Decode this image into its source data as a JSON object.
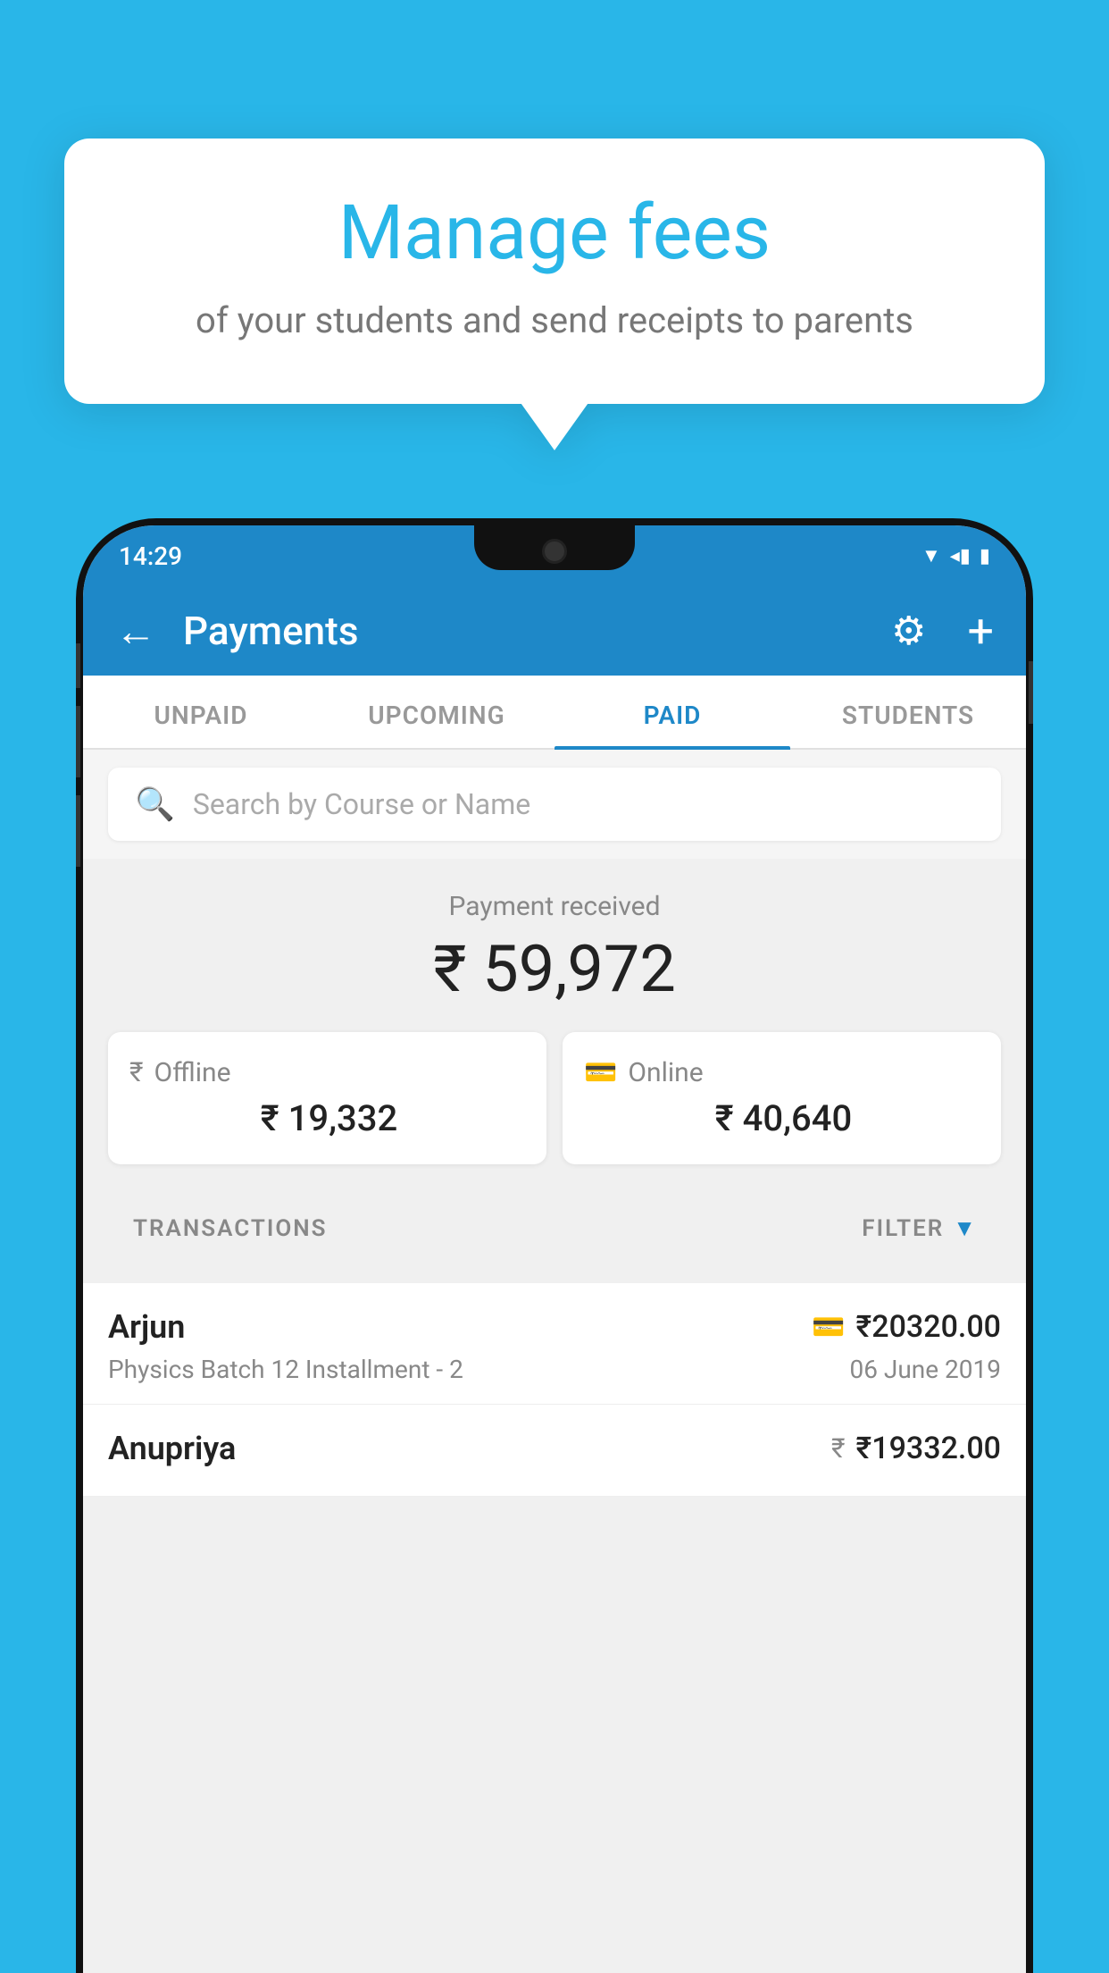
{
  "background_color": "#29b6e8",
  "speech_bubble": {
    "title": "Manage fees",
    "subtitle": "of your students and send receipts to parents"
  },
  "status_bar": {
    "time": "14:29",
    "icons": "▼◂▮"
  },
  "app_bar": {
    "title": "Payments",
    "back_label": "←",
    "gear_label": "⚙",
    "plus_label": "+"
  },
  "tabs": [
    {
      "label": "UNPAID",
      "active": false
    },
    {
      "label": "UPCOMING",
      "active": false
    },
    {
      "label": "PAID",
      "active": true
    },
    {
      "label": "STUDENTS",
      "active": false
    }
  ],
  "search": {
    "placeholder": "Search by Course or Name"
  },
  "payment_summary": {
    "label": "Payment received",
    "amount": "₹ 59,972"
  },
  "payment_cards": [
    {
      "icon": "₹",
      "label": "Offline",
      "amount": "₹ 19,332"
    },
    {
      "icon": "▬",
      "label": "Online",
      "amount": "₹ 40,640"
    }
  ],
  "transactions_header": {
    "label": "TRANSACTIONS",
    "filter_label": "FILTER"
  },
  "transactions": [
    {
      "name": "Arjun",
      "amount": "₹20320.00",
      "detail": "Physics Batch 12 Installment - 2",
      "date": "06 June 2019",
      "icon": "card"
    },
    {
      "name": "Anupriya",
      "amount": "₹19332.00",
      "detail": "",
      "date": "",
      "icon": "cash"
    }
  ]
}
